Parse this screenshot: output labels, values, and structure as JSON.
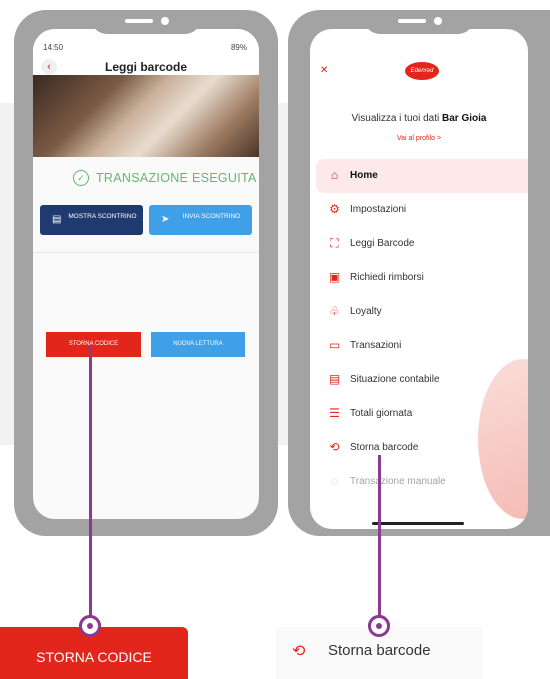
{
  "phone1": {
    "status_time": "14:50",
    "status_battery": "89%",
    "title": "Leggi barcode",
    "success_text": "TRANSAZIONE ESEGUITA",
    "show_receipt_label": "MOSTRA SCONTRINO",
    "send_receipt_label": "INVIA SCONTRINO",
    "storna_label": "STORNA CODICE",
    "new_read_label": "NUOVA LETTURA"
  },
  "phone2": {
    "logo_text": "Edenred",
    "greeting_prefix": "Visualizza i tuoi dati",
    "greeting_name": "Bar Gioia",
    "profile_link": "Vai al profilo >",
    "menu": [
      {
        "label": "Home",
        "icon": "home-icon"
      },
      {
        "label": "Impostazioni",
        "icon": "gear-icon"
      },
      {
        "label": "Leggi Barcode",
        "icon": "barcode-icon"
      },
      {
        "label": "Richiedi rimborsi",
        "icon": "refund-icon"
      },
      {
        "label": "Loyalty",
        "icon": "loyalty-icon"
      },
      {
        "label": "Transazioni",
        "icon": "card-icon"
      },
      {
        "label": "Situazione contabile",
        "icon": "ledger-icon"
      },
      {
        "label": "Totali giornata",
        "icon": "list-icon"
      },
      {
        "label": "Storna barcode",
        "icon": "storna-barcode-icon"
      },
      {
        "label": "Transazione manuale",
        "icon": "manual-icon"
      }
    ]
  },
  "callouts": {
    "zoom_left": "STORNA CODICE",
    "zoom_right": "Storna barcode"
  },
  "colors": {
    "accent": "#e2261c",
    "navy": "#1f3a6f",
    "blue": "#3fa0e8",
    "success": "#63b86c",
    "callout": "#8a3a90"
  }
}
